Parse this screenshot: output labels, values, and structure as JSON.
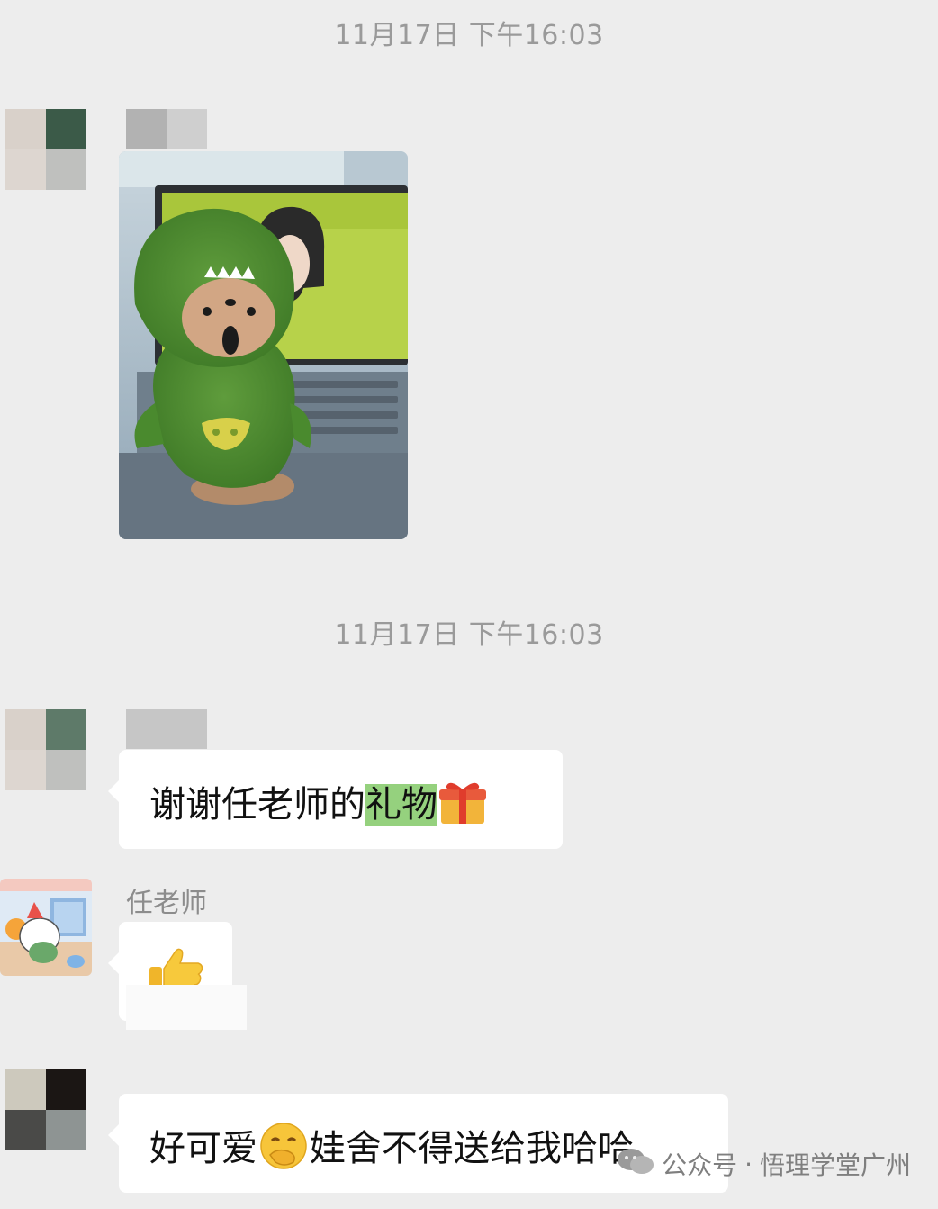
{
  "chat": {
    "timestamps": [
      "11月17日 下午16:03",
      "11月17日 下午16:03"
    ],
    "messages": [
      {
        "type": "image",
        "description": "photo of green dinosaur-costume plush bear"
      },
      {
        "type": "text",
        "text_before": "谢谢任老师的",
        "highlight": "礼物",
        "emoji": "gift-emoji"
      },
      {
        "type": "sticker",
        "sender": "任老师",
        "emoji": "thumbs-up-emoji"
      },
      {
        "type": "text",
        "text_before": "好可爱",
        "emoji": "thinking-hand-emoji",
        "text_after": "娃舍不得送给我哈哈"
      }
    ]
  },
  "watermark": {
    "prefix": "公众号",
    "separator": "·",
    "name": "悟理学堂广州"
  },
  "colors": {
    "background": "#ededed",
    "bubble": "#ffffff",
    "highlight": "#95d17e",
    "timestamp": "#9a9a9a"
  }
}
